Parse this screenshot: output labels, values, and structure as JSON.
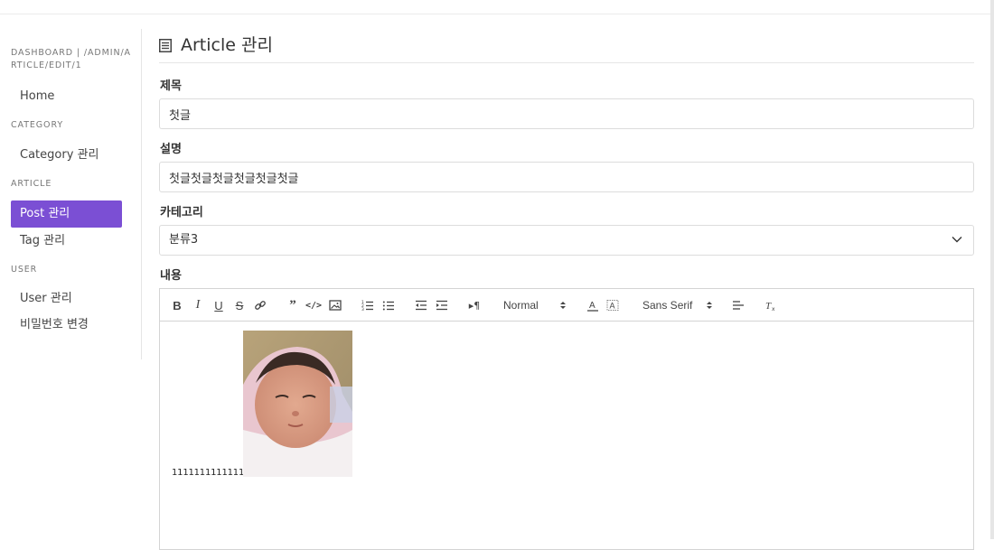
{
  "sidebar": {
    "breadcrumb": "DASHBOARD | /ADMIN/ARTICLE/EDIT/1",
    "home": "Home",
    "sections": {
      "category": "CATEGORY",
      "article": "ARTICLE",
      "user": "USER"
    },
    "items": {
      "category_manage": "Category 관리",
      "post_manage": "Post 관리",
      "tag_manage": "Tag 관리",
      "user_manage": "User 관리",
      "password_change": "비밀번호 변경"
    }
  },
  "page": {
    "title": "Article 관리",
    "fields": {
      "title_label": "제목",
      "title_value": "첫글",
      "description_label": "설명",
      "description_value": "첫글첫글첫글첫글첫글첫글",
      "category_label": "카테고리",
      "category_value": "분류3",
      "content_label": "내용"
    },
    "editor": {
      "header_picker": "Normal",
      "font_picker": "Sans Serif",
      "body_text": "111111111111111"
    }
  },
  "colors": {
    "accent": "#7b4fd4"
  }
}
